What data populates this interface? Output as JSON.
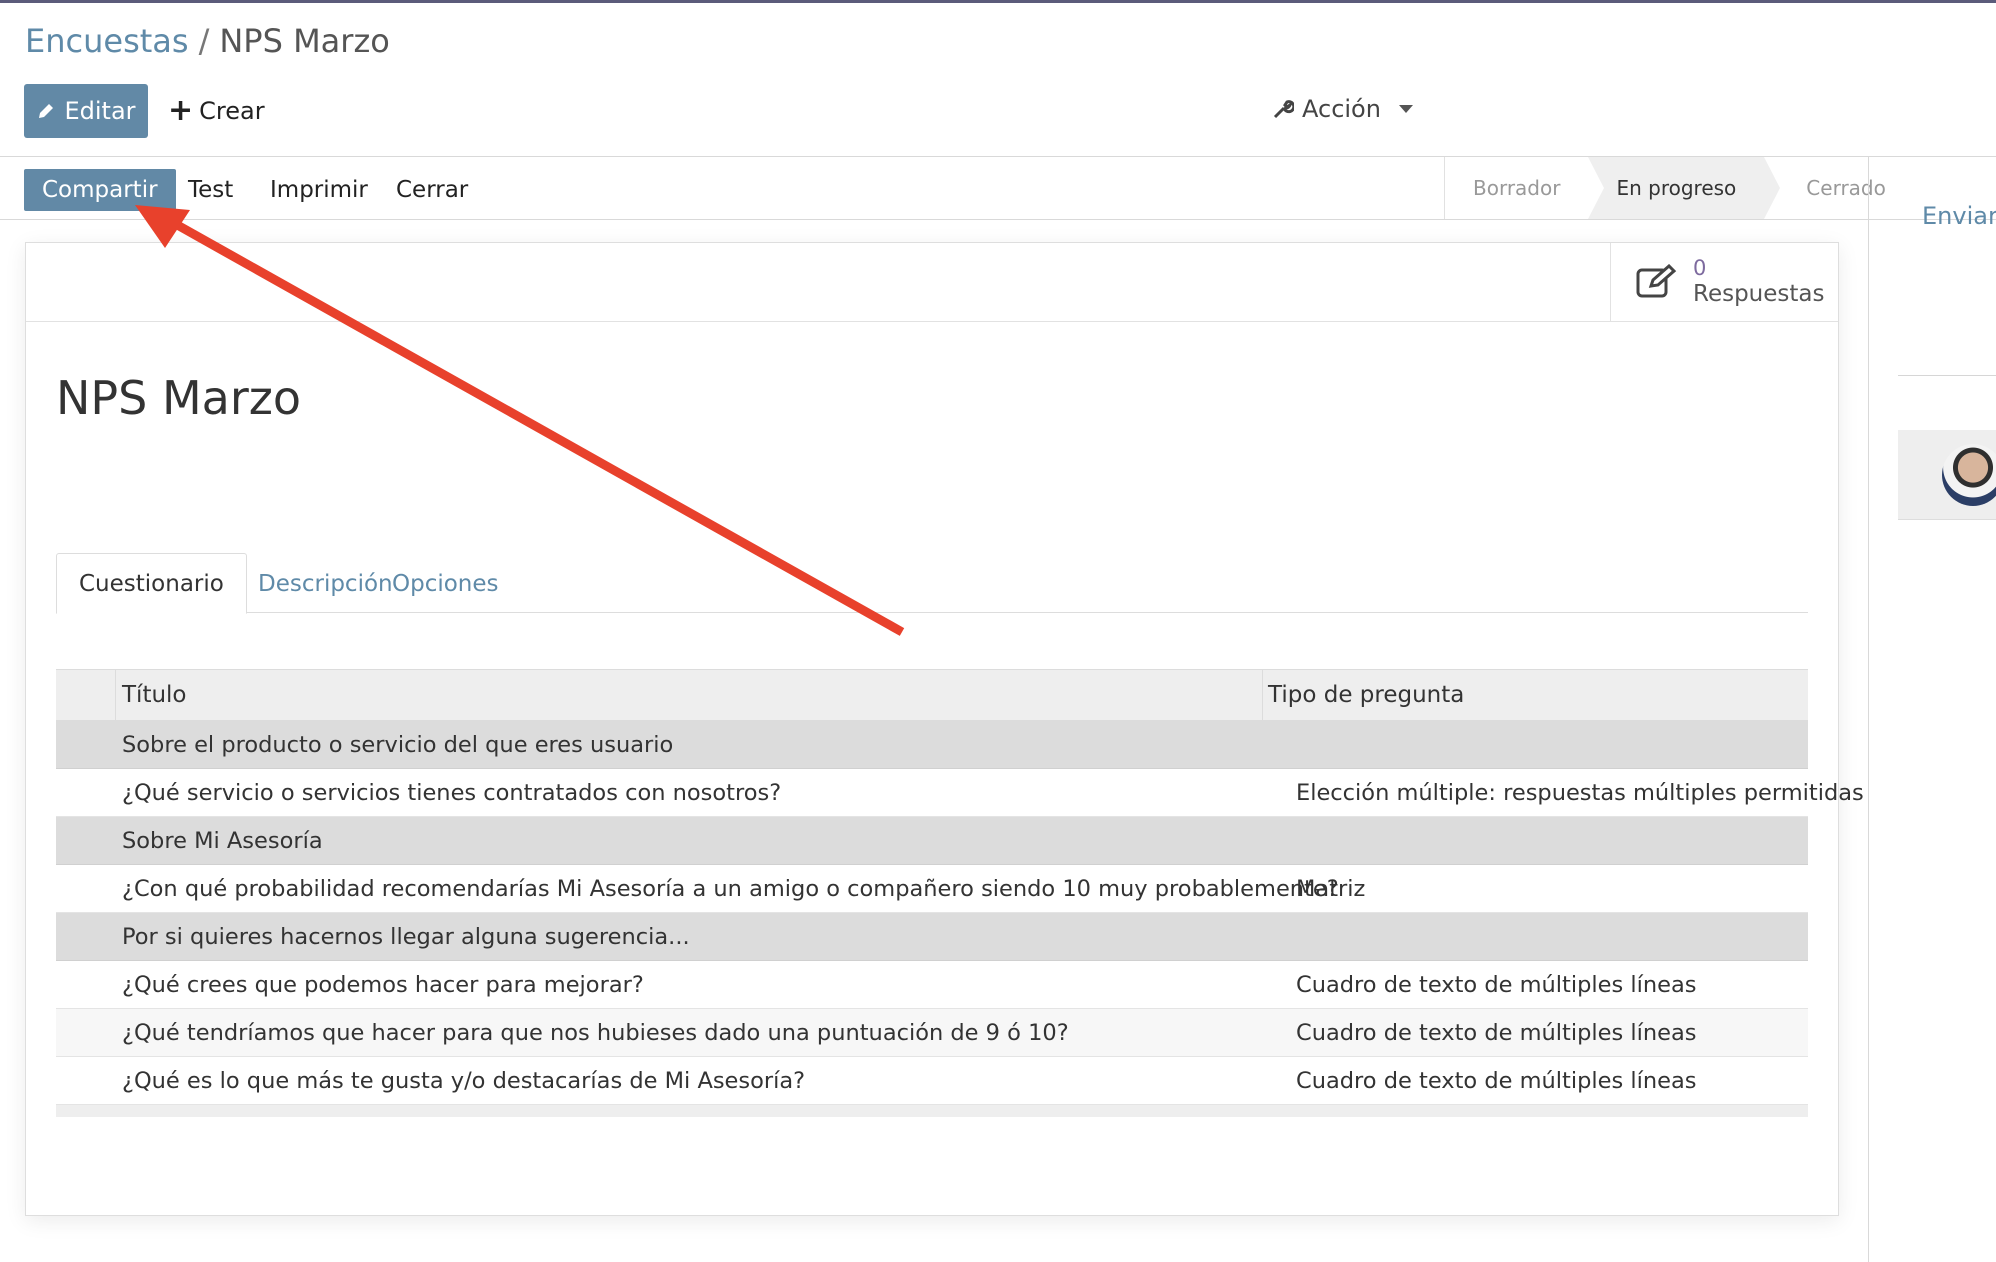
{
  "breadcrumb": {
    "parent": "Encuestas",
    "separator": "/",
    "current": "NPS Marzo"
  },
  "toolbar": {
    "edit_label": "Editar",
    "create_label": "Crear",
    "action_label": "Acción"
  },
  "statusbar": {
    "buttons": [
      "Compartir",
      "Test",
      "Imprimir",
      "Cerrar"
    ],
    "stages": [
      "Borrador",
      "En progreso",
      "Cerrado"
    ],
    "active_stage": "En progreso"
  },
  "stat_button": {
    "value": "0",
    "label": "Respuestas"
  },
  "form": {
    "title": "NPS Marzo"
  },
  "tabs": [
    "Cuestionario",
    "Descripción",
    "Opciones"
  ],
  "table": {
    "headers": [
      "Título",
      "Tipo de pregunta"
    ],
    "rows": [
      {
        "title": "Sobre el producto o servicio del que eres usuario",
        "type": "",
        "section": true
      },
      {
        "title": "¿Qué servicio o servicios tienes contratados con nosotros?",
        "type": "Elección múltiple: respuestas múltiples permitidas",
        "section": false
      },
      {
        "title": "Sobre Mi Asesoría",
        "type": "",
        "section": true
      },
      {
        "title": "¿Con qué probabilidad recomendarías Mi Asesoría a un amigo o compañero siendo 10 muy probablemente?",
        "type": "Matriz",
        "section": false
      },
      {
        "title": "Por si quieres hacernos llegar alguna sugerencia...",
        "type": "",
        "section": true
      },
      {
        "title": "¿Qué crees que podemos hacer para mejorar?",
        "type": "Cuadro de texto de múltiples líneas",
        "section": false
      },
      {
        "title": "¿Qué tendríamos que hacer para que nos hubieses dado una puntuación de 9 ó 10?",
        "type": "Cuadro de texto de múltiples líneas",
        "section": false
      },
      {
        "title": "¿Qué es lo que más te gusta y/o destacarías de Mi Asesoría?",
        "type": "Cuadro de texto de múltiples líneas",
        "section": false
      }
    ]
  },
  "chatter": {
    "send_message_label": "Enviar m"
  },
  "colors": {
    "primary": "#6289a6",
    "link": "#5f8aa8",
    "annotation_arrow": "#e8412c",
    "section_row": "#dcdcdc"
  }
}
